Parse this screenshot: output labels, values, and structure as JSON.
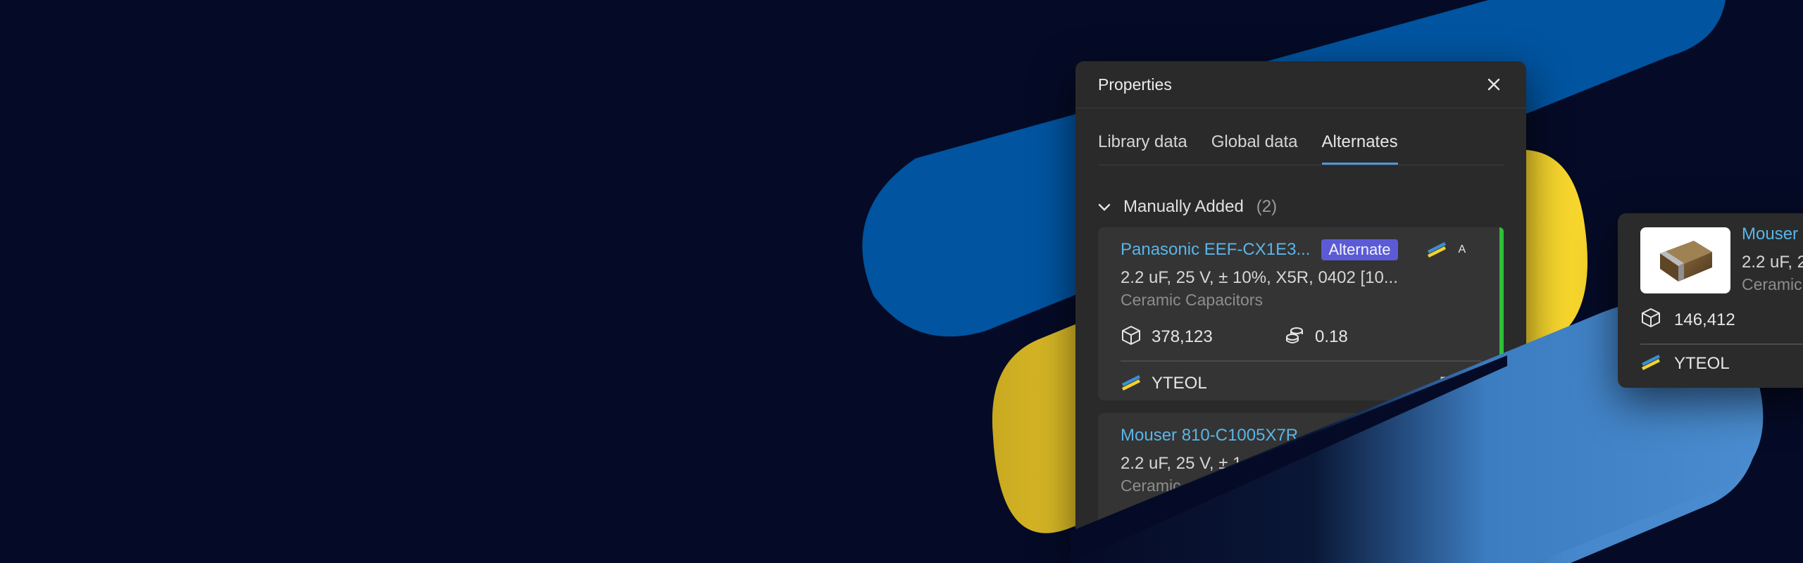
{
  "colors": {
    "background": "#050b26",
    "blue_dark": "#0054a0",
    "blue_light": "#4a8acd",
    "yellow": "#f7d62d",
    "accent_green": "#2fbf3a",
    "badge_purple": "#5b5bd6",
    "link": "#59b5e8"
  },
  "panel": {
    "title": "Properties",
    "close_icon": "close-icon",
    "tabs": [
      {
        "label": "Library data",
        "active": false
      },
      {
        "label": "Global data",
        "active": false
      },
      {
        "label": "Alternates",
        "active": true
      }
    ],
    "section": {
      "label": "Manually Added",
      "count": "(2)",
      "icon": "chevron-down-icon"
    },
    "cards": [
      {
        "part": "Panasonic EEF-CX1E3...",
        "badge": "Alternate",
        "badge_trailing": "A",
        "description": "2.2 uF, 25 V, ± 10%, X5R, 0402 [10...",
        "category": "Ceramic Capacitors",
        "stock": "378,123",
        "price": "0.18",
        "lifecycle": "YTEOL",
        "lifecycle_right": "5+ ye"
      },
      {
        "part": "Mouser 810-C1005X7R",
        "description": "2.2 uF, 25 V, ± 1",
        "category": "Ceramic"
      }
    ]
  },
  "detail_card": {
    "part": "Mouser",
    "description": "2.2 uF, 2",
    "category": "Ceramic",
    "stock": "146,412",
    "lifecycle": "YTEOL"
  }
}
